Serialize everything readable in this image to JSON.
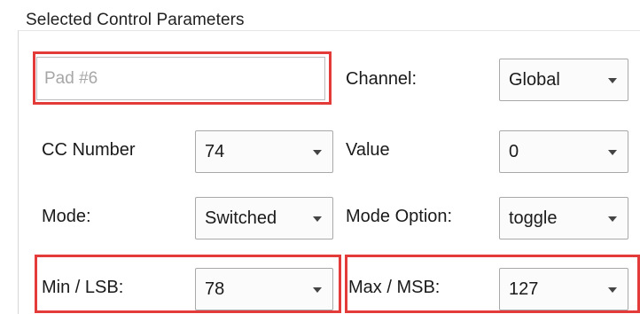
{
  "group": {
    "title": "Selected Control Parameters"
  },
  "name_field": {
    "value": "Pad #6"
  },
  "rows": [
    {
      "left_label": "",
      "left_value": "",
      "right_label": "Channel:",
      "right_value": "Global"
    },
    {
      "left_label": "CC Number",
      "left_value": "74",
      "right_label": "Value",
      "right_value": "0"
    },
    {
      "left_label": "Mode:",
      "left_value": "Switched",
      "right_label": "Mode Option:",
      "right_value": "toggle"
    },
    {
      "left_label": "Min / LSB:",
      "left_value": "78",
      "right_label": "Max / MSB:",
      "right_value": "127"
    }
  ],
  "highlight_color": "#e33a3a"
}
